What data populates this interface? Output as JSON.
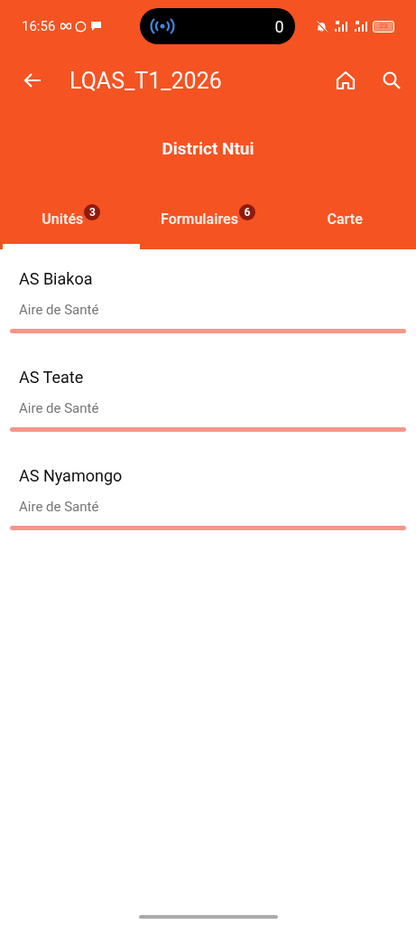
{
  "status_bar": {
    "time": "16:56",
    "pill_count": "0",
    "battery": "23"
  },
  "app_bar": {
    "title": "LQAS_T1_2026"
  },
  "header": {
    "title": "District Ntui"
  },
  "tabs": [
    {
      "label": "Unités",
      "badge": "3",
      "selected": true
    },
    {
      "label": "Formulaires",
      "badge": "6",
      "selected": false
    },
    {
      "label": "Carte",
      "selected": false
    }
  ],
  "units": [
    {
      "name": "AS Biakoa",
      "type": "Aire de Santé"
    },
    {
      "name": "AS Teate",
      "type": "Aire de Santé"
    },
    {
      "name": "AS Nyamongo",
      "type": "Aire de Santé"
    }
  ]
}
